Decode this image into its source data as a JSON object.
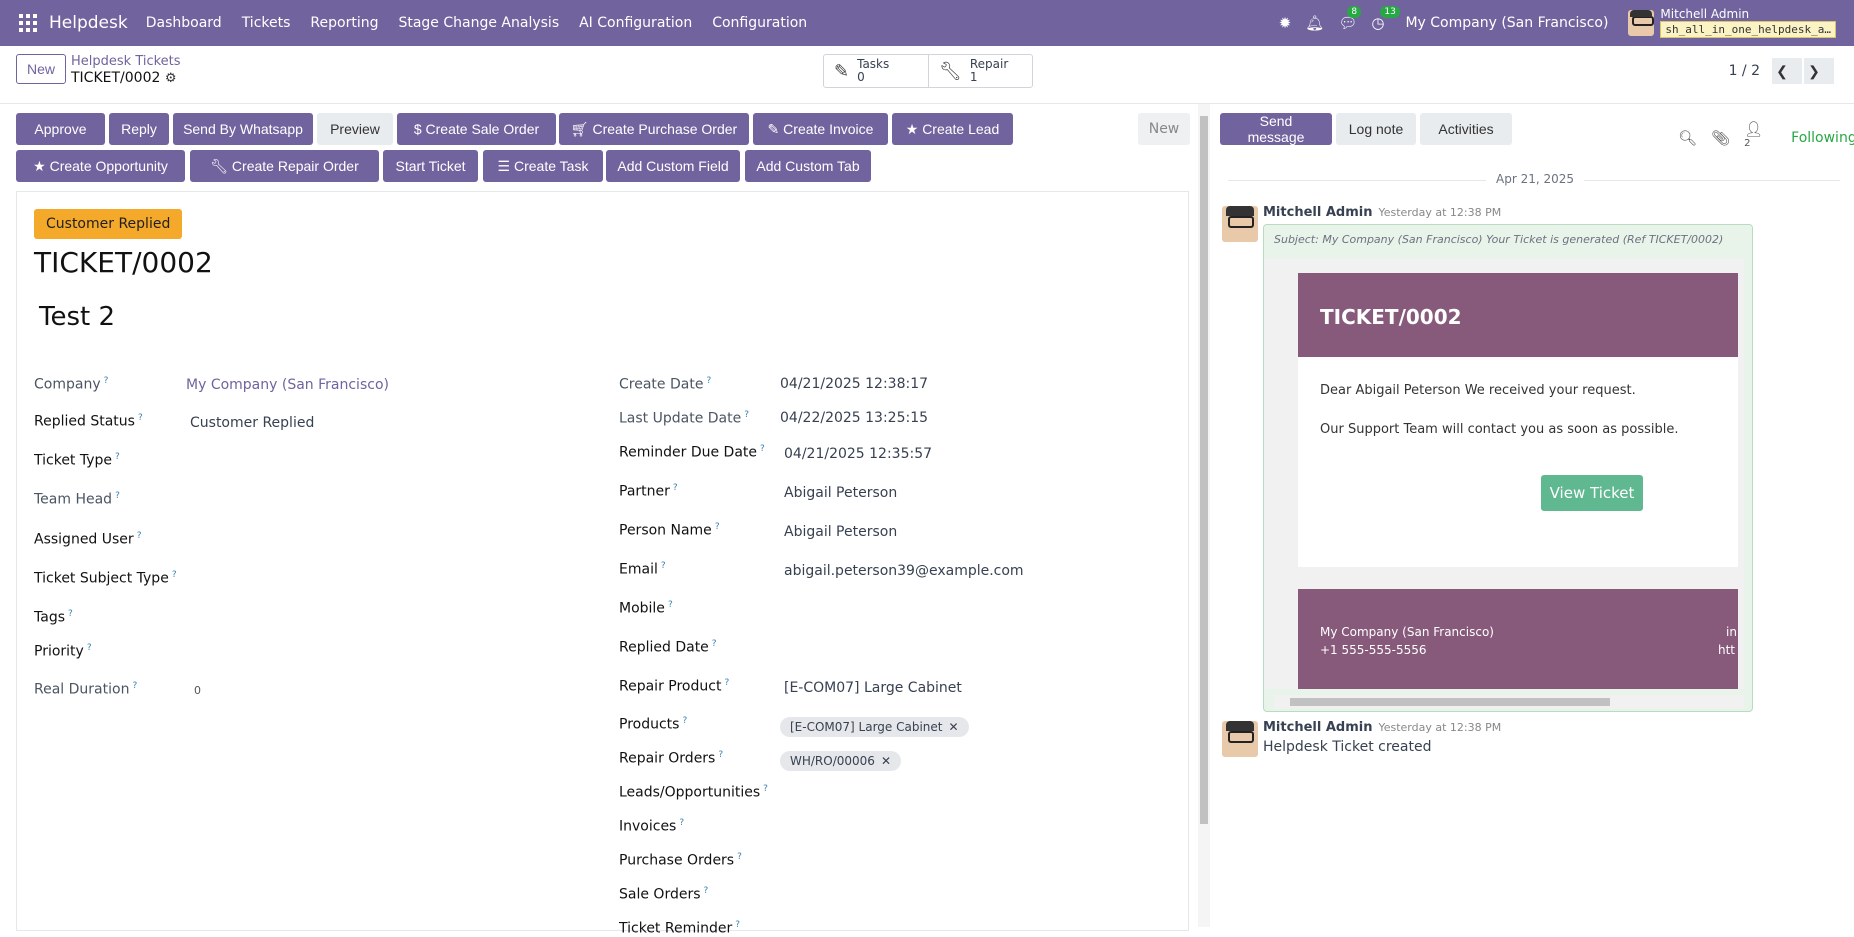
{
  "nav": {
    "brand": "Helpdesk",
    "menu": [
      "Dashboard",
      "Tickets",
      "Reporting",
      "Stage Change Analysis",
      "AI Configuration",
      "Configuration"
    ],
    "chat_badge": "8",
    "activity_badge": "13",
    "company": "My Company (San Francisco)",
    "user_name": "Mitchell Admin",
    "database": "sh_all_in_one_helpdesk_a…"
  },
  "control": {
    "new_label": "New",
    "breadcrumb_parent": "Helpdesk Tickets",
    "breadcrumb_current": "TICKET/0002",
    "smart": [
      {
        "label": "Tasks",
        "value": "0"
      },
      {
        "label": "Repair",
        "value": "1"
      }
    ],
    "pager": "1 / 2"
  },
  "toolbar": {
    "approve": "Approve",
    "reply": "Reply",
    "whatsapp": "Send By Whatsapp",
    "preview": "Preview",
    "sale_order": "Create Sale Order",
    "purchase_order": "Create Purchase Order",
    "invoice": "Create Invoice",
    "lead": "Create Lead",
    "opportunity": "Create Opportunity",
    "repair_order": "Create Repair Order",
    "start_ticket": "Start Ticket",
    "task": "Create Task",
    "custom_field": "Add Custom Field",
    "custom_tab": "Add Custom Tab",
    "stage": "New"
  },
  "ticket": {
    "status_tag": "Customer Replied",
    "number": "TICKET/0002",
    "name": "Test 2"
  },
  "left_fields": {
    "company_label": "Company",
    "company_value": "My Company (San Francisco)",
    "replied_status_label": "Replied Status",
    "replied_status_value": "Customer Replied",
    "ticket_type_label": "Ticket Type",
    "team_head_label": "Team Head",
    "assigned_user_label": "Assigned User",
    "subject_type_label": "Ticket Subject Type",
    "tags_label": "Tags",
    "priority_label": "Priority",
    "real_duration_label": "Real Duration",
    "real_duration_value": "0"
  },
  "right_fields": {
    "create_date_label": "Create Date",
    "create_date_value": "04/21/2025 12:38:17",
    "last_update_label": "Last Update Date",
    "last_update_value": "04/22/2025 13:25:15",
    "reminder_label": "Reminder Due Date",
    "reminder_value": "04/21/2025 12:35:57",
    "partner_label": "Partner",
    "partner_value": "Abigail Peterson",
    "person_label": "Person Name",
    "person_value": "Abigail Peterson",
    "email_label": "Email",
    "email_value": "abigail.peterson39@example.com",
    "mobile_label": "Mobile",
    "replied_date_label": "Replied Date",
    "repair_product_label": "Repair Product",
    "repair_product_value": "[E-COM07] Large Cabinet",
    "products_label": "Products",
    "products_chip": "[E-COM07] Large Cabinet",
    "repair_orders_label": "Repair Orders",
    "repair_orders_chip": "WH/RO/00006",
    "leads_label": "Leads/Opportunities",
    "invoices_label": "Invoices",
    "purchase_orders_label": "Purchase Orders",
    "sale_orders_label": "Sale Orders",
    "ticket_reminder_label": "Ticket Reminder"
  },
  "chatter": {
    "send_message": "Send message",
    "log_note": "Log note",
    "activities": "Activities",
    "followers_count": "2",
    "following": "Following",
    "date_separator": "Apr 21, 2025",
    "msg1": {
      "author": "Mitchell Admin",
      "time": "Yesterday at 12:38 PM",
      "subject": "Subject: My Company (San Francisco) Your Ticket is generated (Ref TICKET/0002)",
      "mail_title": "TICKET/0002",
      "line1": "Dear Abigail Peterson We received your request.",
      "line2": "Our Support Team will contact you as soon as possible.",
      "button": "View Ticket",
      "footer_company": "My Company (San Francisco)",
      "footer_phone": "+1 555-555-5556",
      "footer_right1": "in",
      "footer_right2": "htt"
    },
    "msg2": {
      "author": "Mitchell Admin",
      "time": "Yesterday at 12:38 PM",
      "body": "Helpdesk Ticket created"
    }
  }
}
